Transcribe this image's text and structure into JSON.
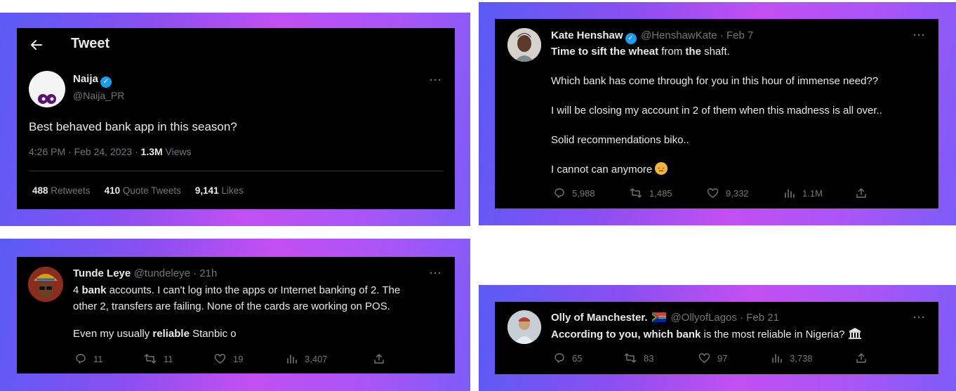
{
  "tweet1": {
    "header_title": "Tweet",
    "name": "Naija",
    "handle": "@Naija_PR",
    "text": "Best behaved bank app in this season?",
    "time": "4:26 PM · Feb 24, 2023 · ",
    "views_count": "1.3M",
    "views_label": " Views",
    "retweets_count": "488",
    "retweets_label": " Retweets",
    "quotes_count": "410",
    "quotes_label": " Quote Tweets",
    "likes_count": "9,141",
    "likes_label": " Likes"
  },
  "tweet2": {
    "name": "Kate Henshaw",
    "handle": "@HenshawKate · Feb 7",
    "line1_a": "Time to sift the wheat",
    "line1_b": " from ",
    "line1_c": "the",
    "line1_d": " shaft.",
    "para2": "Which bank has come through for you in this hour of immense need??",
    "para3": "I will be closing my account in 2 of them when this madness is all over..",
    "para4": "Solid recommendations biko..",
    "para5": "I cannot can anymore",
    "replies": "5,988",
    "retweets": "1,485",
    "likes": "9,332",
    "views": "1.1M"
  },
  "tweet3": {
    "name": "Tunde Leye",
    "handle": "@tundeleye · 21h",
    "line1_a": "4 ",
    "line1_b": "bank",
    "line1_c": " accounts. I can't log into the apps or Internet banking of 2. The",
    "line2": "other 2, transfers are failing. None of the cards are working on POS.",
    "line3_a": "Even my usually ",
    "line3_b": "reliable",
    "line3_c": " Stanbic o",
    "replies": "11",
    "retweets": "11",
    "likes": "19",
    "views": "3,407"
  },
  "tweet4": {
    "name": "Olly of Manchester.",
    "handle": "@OllyofLagos · Feb 21",
    "text_a": "According to you, which bank",
    "text_b": " is the most reliable in Nigeria?",
    "replies": "65",
    "retweets": "83",
    "likes": "97",
    "views": "3,738"
  },
  "icons": {
    "back": "back-arrow-icon",
    "verified": "verified-badge-icon",
    "more": "more-icon",
    "reply": "reply-icon",
    "retweet": "retweet-icon",
    "like": "like-icon",
    "views": "views-icon",
    "share": "share-icon"
  },
  "colors": {
    "card_bg": "#000000",
    "text": "#e7e9ea",
    "muted": "#71767b",
    "verified": "#1d9bf0",
    "gradient_start": "#5a5bf5",
    "gradient_mid": "#c24ff2"
  }
}
